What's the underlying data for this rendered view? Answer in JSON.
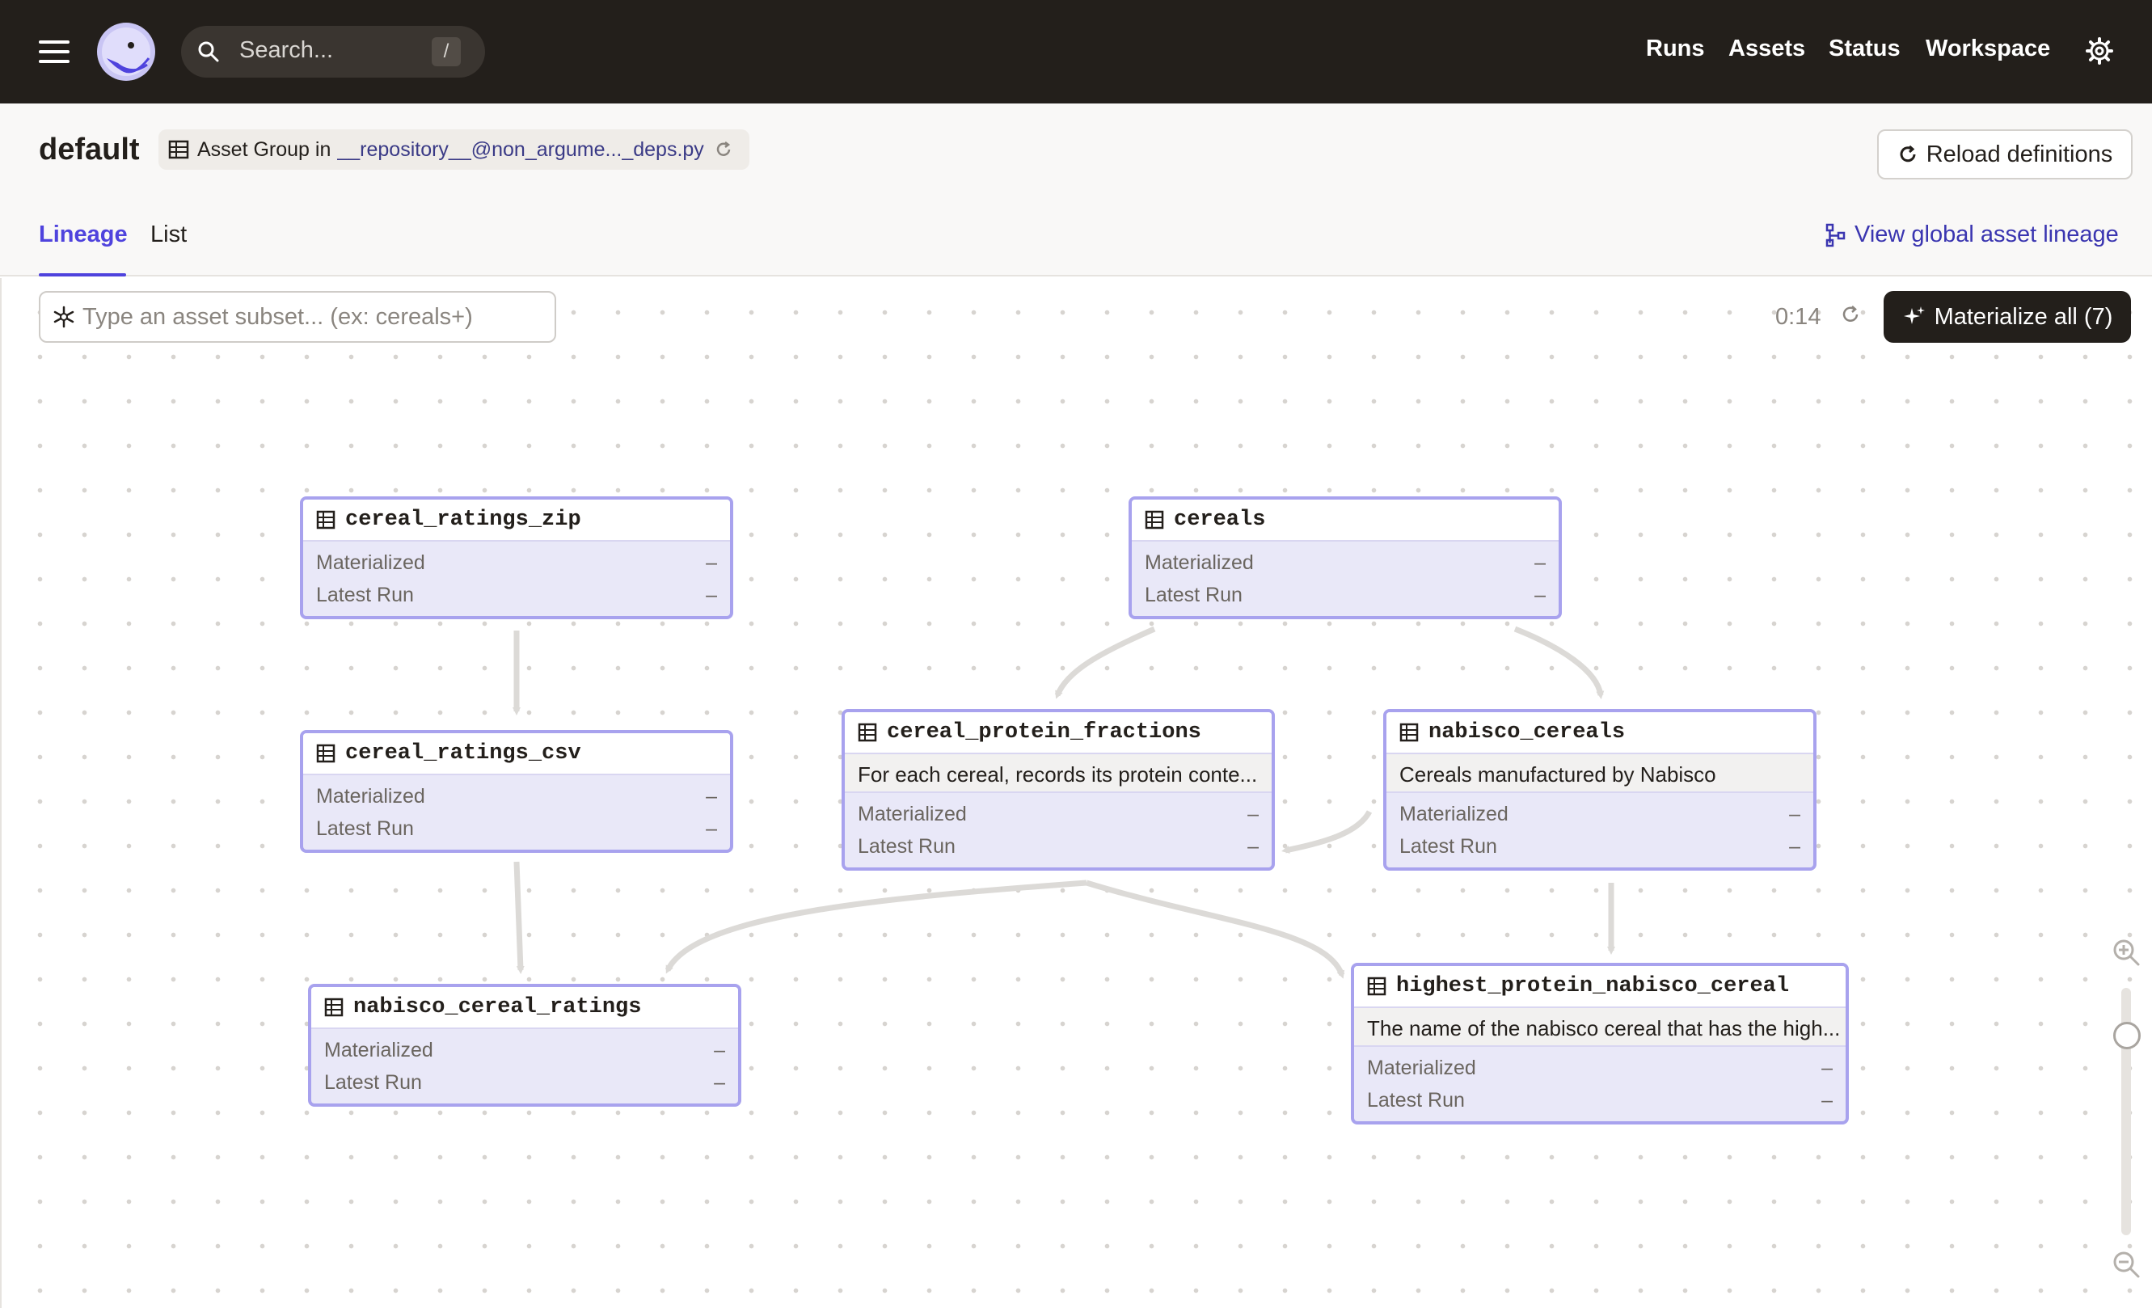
{
  "topbar": {
    "search_placeholder": "Search...",
    "search_shortcut": "/",
    "nav": [
      "Runs",
      "Assets",
      "Status",
      "Workspace"
    ],
    "icons": {
      "menu": "hamburger-menu-icon",
      "logo": "dagster-logo",
      "search": "search-icon",
      "settings": "gear-icon"
    }
  },
  "header": {
    "title": "default",
    "group_prefix": "Asset Group in",
    "group_location": "__repository__@non_argume..._deps.py",
    "reload_label": "Reload definitions"
  },
  "tabs": [
    {
      "label": "Lineage",
      "active": true
    },
    {
      "label": "List",
      "active": false
    }
  ],
  "view_global_label": "View global asset lineage",
  "toolbar": {
    "subset_placeholder": "Type an asset subset... (ex: cereals+)",
    "timer": "0:14",
    "materialize_label": "Materialize all (7)"
  },
  "graph": {
    "row_labels": {
      "materialized": "Materialized",
      "latest_run": "Latest Run"
    },
    "nodes": [
      {
        "name": "cereal_ratings_zip",
        "description": "",
        "materialized": "–",
        "latest_run": "–"
      },
      {
        "name": "cereals",
        "description": "",
        "materialized": "–",
        "latest_run": "–"
      },
      {
        "name": "cereal_ratings_csv",
        "description": "",
        "materialized": "–",
        "latest_run": "–"
      },
      {
        "name": "cereal_protein_fractions",
        "description": "For each cereal, records its protein conte...",
        "materialized": "–",
        "latest_run": "–"
      },
      {
        "name": "nabisco_cereals",
        "description": "Cereals manufactured by Nabisco",
        "materialized": "–",
        "latest_run": "–"
      },
      {
        "name": "nabisco_cereal_ratings",
        "description": "",
        "materialized": "–",
        "latest_run": "–"
      },
      {
        "name": "highest_protein_nabisco_cereal",
        "description": "The name of the nabisco cereal that has the high...",
        "materialized": "–",
        "latest_run": "–"
      }
    ],
    "edges": [
      [
        "cereal_ratings_zip",
        "cereal_ratings_csv"
      ],
      [
        "cereals",
        "cereal_protein_fractions"
      ],
      [
        "cereals",
        "nabisco_cereals"
      ],
      [
        "cereal_ratings_csv",
        "nabisco_cereal_ratings"
      ],
      [
        "cereal_protein_fractions",
        "nabisco_cereal_ratings"
      ],
      [
        "cereal_protein_fractions",
        "highest_protein_nabisco_cereal"
      ],
      [
        "nabisco_cereals",
        "highest_protein_nabisco_cereal"
      ]
    ]
  },
  "colors": {
    "topbar": "#231f1b",
    "accent": "#4f43dd",
    "node_border": "#a8a2ee",
    "node_fill": "#e9e8f8"
  }
}
